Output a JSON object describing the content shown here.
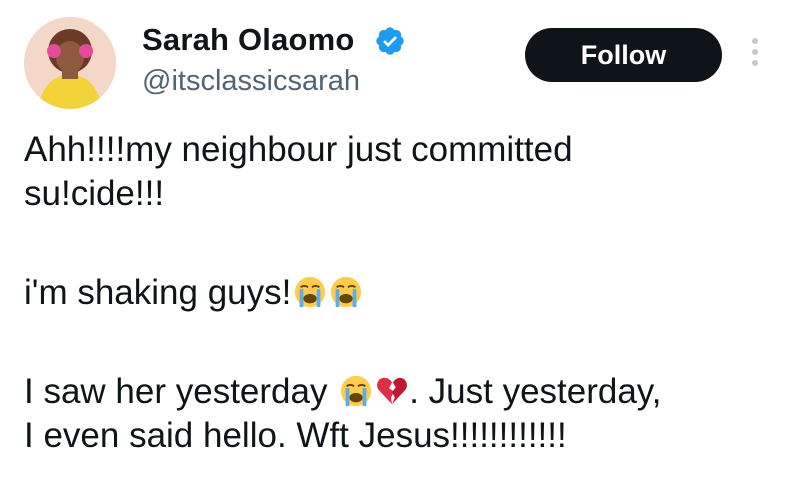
{
  "user": {
    "display_name": "Sarah Olaomo",
    "handle": "@itsclassicsarah",
    "verified": true,
    "verified_color": "#1d9bf0"
  },
  "follow_label": "Follow",
  "tweet": {
    "line1": "Ahh!!!!my neighbour just committed",
    "line2": "su!cide!!!",
    "line3": " i'm shaking guys!",
    "line4_start": "I saw her yesterday ",
    "line4_end": ". Just yesterday,",
    "line5": "I even said hello. Wft Jesus!!!!!!!!!!!!"
  },
  "icons": {
    "avatar": "profile-photo",
    "verified": "verified-badge-icon",
    "more": "more-options-icon",
    "crying": "loudly-crying-face-emoji",
    "broken_heart": "broken-heart-emoji"
  },
  "colors": {
    "text": "#0f1419",
    "secondary": "#536471",
    "button_bg": "#0f1419",
    "button_text": "#ffffff"
  }
}
